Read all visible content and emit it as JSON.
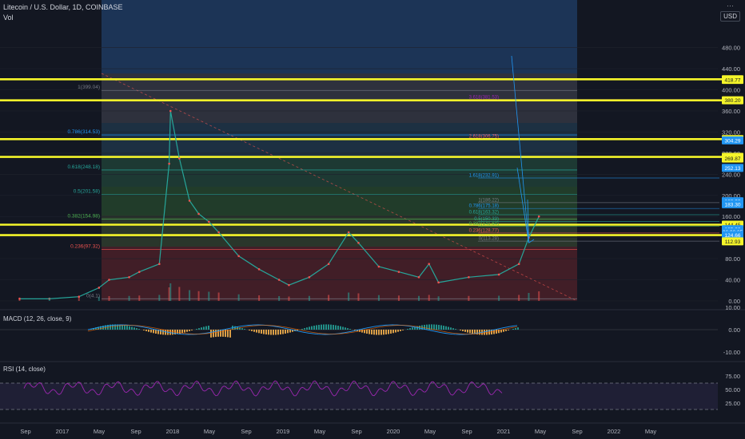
{
  "header": {
    "symbol": "Litecoin / U.S. Dollar, 1D, COINBASE",
    "volume_label": "Vol",
    "currency_badge": "USD"
  },
  "icons": {
    "menu": "dots-menu-icon"
  },
  "colors": {
    "background": "#131722",
    "key_level": "#f5f52a",
    "fib_blue": "#2962ff",
    "macd_line": "#2196f3",
    "signal_line": "#ff6d00",
    "rsi_line": "#9c27b0",
    "trend": "#ef5350"
  },
  "chart_data": [
    {
      "type": "line",
      "pane": "price",
      "series": [
        {
          "name": "Litecoin / U.S. Dollar",
          "x": [
            "2016-09",
            "2016-12",
            "2017-03",
            "2017-05",
            "2017-06",
            "2017-08",
            "2017-09",
            "2017-11",
            "2017-12",
            "2017-12-19",
            "2018-01",
            "2018-02",
            "2018-03",
            "2018-04",
            "2018-05",
            "2018-07",
            "2018-09",
            "2018-11",
            "2018-12",
            "2019-02",
            "2019-04",
            "2019-06",
            "2019-07",
            "2019-09",
            "2019-11",
            "2020-01",
            "2020-02",
            "2020-03",
            "2020-06",
            "2020-09",
            "2020-11",
            "2020-12",
            "2021-01"
          ],
          "y": [
            4,
            4,
            8,
            25,
            40,
            45,
            55,
            70,
            260,
            360,
            270,
            190,
            165,
            150,
            130,
            85,
            60,
            40,
            30,
            45,
            70,
            130,
            110,
            65,
            55,
            45,
            70,
            35,
            45,
            50,
            70,
            120,
            160
          ]
        }
      ],
      "y_axis_ticks": [
        "480.00",
        "440.00",
        "400.00",
        "360.00",
        "320.00",
        "280.00",
        "240.00",
        "200.00",
        "160.00",
        "120.00",
        "80.00",
        "40.00",
        "0.00"
      ],
      "x_axis_ticks": [
        "Sep",
        "2017",
        "May",
        "Sep",
        "2018",
        "May",
        "Sep",
        "2019",
        "May",
        "Sep",
        "2020",
        "May",
        "Sep",
        "2021",
        "May",
        "Sep",
        "2022",
        "May"
      ],
      "price_tags": [
        "420.05",
        "418.77",
        "380.20",
        "306.65",
        "304.29",
        "272.98",
        "269.87",
        "252.13",
        "188.93",
        "183.30",
        "144.45",
        "135.92",
        "06:06:35",
        "124.66",
        "112.93"
      ],
      "fib_retracement_labels": [
        "1(399.04)",
        "0.786(314.53)",
        "0.618(248.18)",
        "0.5(201.58)",
        "0.382(154.98)",
        "0.236(97.32)",
        "0(4.1)"
      ],
      "fib_extension_labels": [
        "3.618(381.53)",
        "2.618(306.75)",
        "1.618(232.91)",
        "1(186.22)",
        "0.786(175.18)",
        "0.618(163.32)",
        "0.5(150.33)",
        "0.382(141.64)",
        "0.236(128.77)",
        "0(113.28)"
      ],
      "key_levels": [
        420.05,
        380.2,
        306.65,
        272.98,
        144.45,
        124.66
      ],
      "ylim": [
        0,
        540
      ],
      "grid": true
    },
    {
      "type": "bar",
      "pane": "macd",
      "title": "MACD (12, 26, close, 9)",
      "y_axis_ticks": [
        "10.00",
        "0.00",
        "-10.00"
      ],
      "ylim": [
        -15,
        15
      ]
    },
    {
      "type": "line",
      "pane": "rsi",
      "title": "RSI (14, close)",
      "y_axis_ticks": [
        "75.00",
        "50.00",
        "25.00"
      ],
      "ylim": [
        0,
        100
      ]
    }
  ]
}
